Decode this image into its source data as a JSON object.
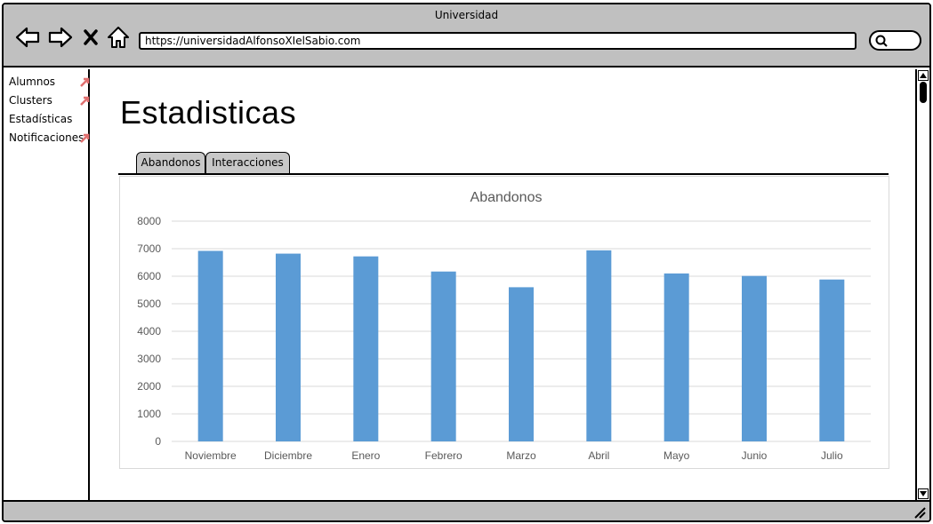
{
  "window": {
    "title": "Universidad"
  },
  "browser": {
    "url": "https://universidadAlfonsoXIelSabio.com",
    "icons": [
      "back-icon",
      "forward-icon",
      "close-icon",
      "home-icon",
      "search-icon"
    ]
  },
  "sidebar": {
    "items": [
      {
        "label": "Alumnos",
        "icon": "link-icon"
      },
      {
        "label": "Clusters",
        "icon": "link-icon"
      },
      {
        "label": "Estadísticas",
        "icon": ""
      },
      {
        "label": "Notificaciones",
        "icon": "link-icon"
      }
    ]
  },
  "main": {
    "title": "Estadisticas",
    "tabs": [
      {
        "label": "Abandonos",
        "active": true
      },
      {
        "label": "Interacciones",
        "active": false
      }
    ]
  },
  "colors": {
    "bar": "#5b9bd5",
    "chrome": "#c0c0c0",
    "link_icon": "#e07070"
  },
  "chart_data": {
    "type": "bar",
    "title": "Abandonos",
    "xlabel": "",
    "ylabel": "",
    "categories": [
      "Noviembre",
      "Diciembre",
      "Enero",
      "Febrero",
      "Marzo",
      "Abril",
      "Mayo",
      "Junio",
      "Julio"
    ],
    "values": [
      6920,
      6820,
      6720,
      6170,
      5600,
      6940,
      6100,
      6010,
      5880
    ],
    "ylim": [
      0,
      8000
    ],
    "yticks": [
      0,
      1000,
      2000,
      3000,
      4000,
      5000,
      6000,
      7000,
      8000
    ],
    "grid": true,
    "legend": "none"
  }
}
